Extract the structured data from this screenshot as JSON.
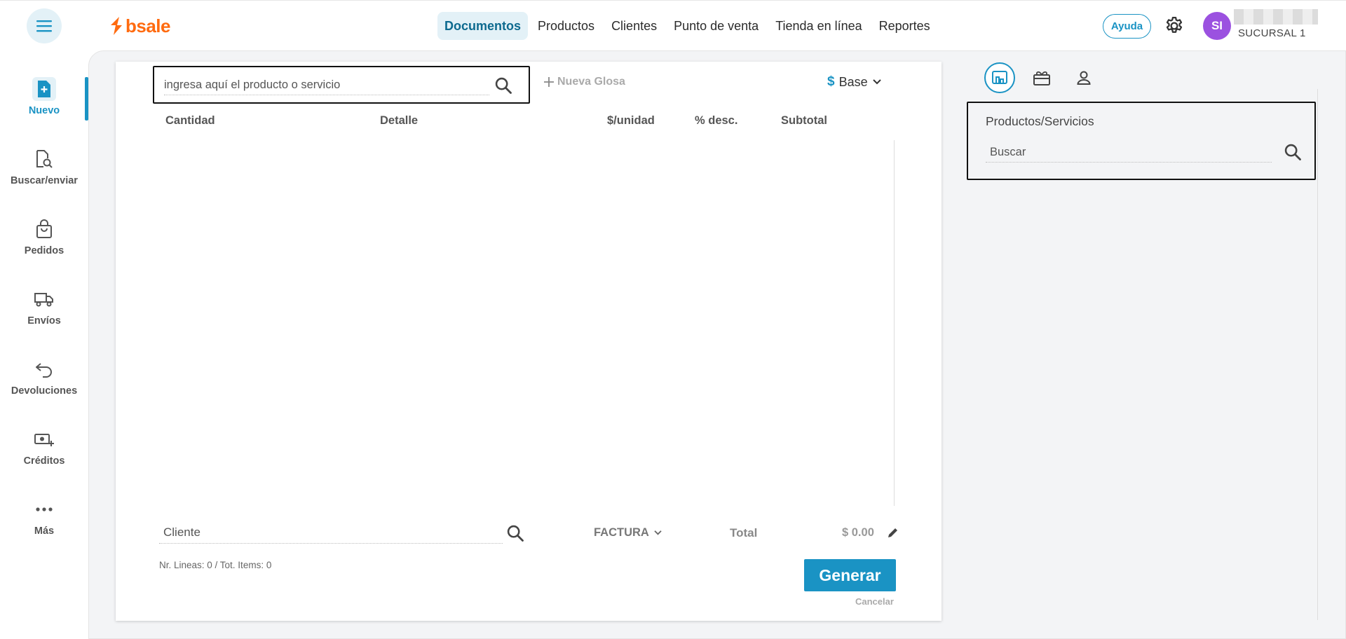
{
  "brand": {
    "name": "bsale",
    "color": "#ff6b10"
  },
  "nav": {
    "items": [
      {
        "label": "Documentos",
        "active": true
      },
      {
        "label": "Productos"
      },
      {
        "label": "Clientes"
      },
      {
        "label": "Punto de venta"
      },
      {
        "label": "Tienda en línea"
      },
      {
        "label": "Reportes"
      }
    ]
  },
  "header": {
    "help_label": "Ayuda",
    "avatar_initials": "SI",
    "branch": "SUCURSAL 1"
  },
  "sidebar": {
    "items": [
      {
        "label": "Nuevo",
        "icon": "new-document-icon",
        "active": true
      },
      {
        "label": "Buscar/enviar",
        "icon": "document-search-icon"
      },
      {
        "label": "Pedidos",
        "icon": "shopping-bag-icon"
      },
      {
        "label": "Envíos",
        "icon": "truck-icon"
      },
      {
        "label": "Devoluciones",
        "icon": "return-arrow-icon"
      },
      {
        "label": "Créditos",
        "icon": "money-plus-icon"
      },
      {
        "label": "Más",
        "icon": "more-dots-icon"
      }
    ]
  },
  "document": {
    "product_search_placeholder": "ingresa aquí el producto o servicio",
    "nueva_glosa_label": "Nueva Glosa",
    "price_list": {
      "symbol": "$",
      "label": "Base"
    },
    "columns": [
      "Cantidad",
      "Detalle",
      "$/unidad",
      "% desc.",
      "Subtotal"
    ],
    "client_placeholder": "Cliente",
    "doc_type": "FACTURA",
    "total_label": "Total",
    "total_value": "$ 0.00",
    "summary": "Nr. Lineas: 0 / Tot. Items: 0",
    "generate_label": "Generar",
    "cancel_label": "Cancelar"
  },
  "right_panel": {
    "tabs": [
      "products-tab-icon",
      "gift-card-icon",
      "user-icon"
    ],
    "title": "Productos/Servicios",
    "search_placeholder": "Buscar"
  },
  "colors": {
    "accent": "#1a93c4",
    "avatar": "#9b51e0"
  }
}
